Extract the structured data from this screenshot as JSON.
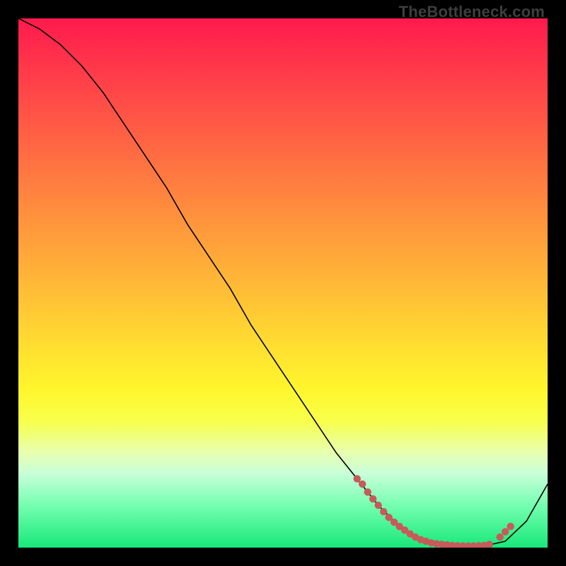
{
  "watermark": "TheBottleneck.com",
  "colors": {
    "page_bg": "#000000",
    "curve": "#000000",
    "dot": "#c75a5a",
    "gradient_top": "#ff1a4d",
    "gradient_bottom": "#18e87a"
  },
  "chart_data": {
    "type": "line",
    "title": "",
    "xlabel": "",
    "ylabel": "",
    "xlim": [
      0,
      100
    ],
    "ylim": [
      0,
      100
    ],
    "x": [
      0,
      4,
      8,
      12,
      16,
      20,
      24,
      28,
      32,
      36,
      40,
      44,
      48,
      52,
      56,
      60,
      64,
      68,
      72,
      76,
      80,
      84,
      88,
      92,
      96,
      100
    ],
    "values": [
      100,
      98,
      95,
      91,
      86,
      80,
      74,
      68,
      61,
      55,
      49,
      42,
      36,
      30,
      24,
      18,
      13,
      8,
      4,
      1.5,
      0.6,
      0.3,
      0.3,
      1.2,
      5,
      12
    ],
    "markers": {
      "x": [
        64,
        65,
        66,
        67,
        68,
        69,
        70,
        71,
        72,
        73,
        74,
        75,
        76,
        77,
        78,
        79,
        80,
        81,
        82,
        83,
        84,
        85,
        86,
        87,
        88,
        89,
        91,
        92,
        93
      ],
      "y": [
        13,
        12,
        10.5,
        9.2,
        8,
        6.8,
        5.7,
        4.8,
        4,
        3.3,
        2.6,
        2,
        1.5,
        1.2,
        0.9,
        0.7,
        0.6,
        0.5,
        0.4,
        0.35,
        0.3,
        0.3,
        0.3,
        0.35,
        0.4,
        0.6,
        2,
        3,
        4
      ]
    }
  }
}
